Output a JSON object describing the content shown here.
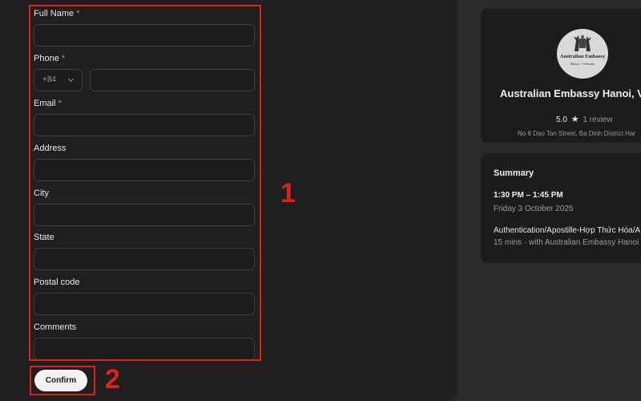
{
  "form": {
    "fields": [
      {
        "label": "Full Name",
        "required_mark": "*",
        "value": "",
        "placeholder": ""
      },
      {
        "label": "Phone",
        "required_mark": "*",
        "country_code": "+84",
        "value": "",
        "placeholder": ""
      },
      {
        "label": "Email",
        "required_mark": "*",
        "value": "",
        "placeholder": ""
      },
      {
        "label": "Address",
        "value": "",
        "placeholder": ""
      },
      {
        "label": "City",
        "value": "",
        "placeholder": ""
      },
      {
        "label": "State",
        "value": "",
        "placeholder": ""
      },
      {
        "label": "Postal code",
        "value": "",
        "placeholder": ""
      },
      {
        "label": "Comments",
        "value": "",
        "placeholder": ""
      }
    ],
    "confirm_label": "Confirm"
  },
  "annotations": {
    "form_marker": "1",
    "confirm_marker": "2",
    "highlight_color": "#e0201c"
  },
  "embassy": {
    "logo_text": "Australian Embassy",
    "logo_subtext": "Hanoi - Vietnam",
    "name": "Australian Embassy Hanoi, Vie",
    "rating": "5.0",
    "star_icon": "star-icon",
    "reviews": "1 review",
    "address": "No 8 Dao Tan Street, Ba Dinh District Har"
  },
  "summary": {
    "title": "Summary",
    "time_range": "1:30 PM – 1:45 PM",
    "date": "Friday 3 October 2025",
    "service": "Authentication/Apostille-Hợp Thức Hóa/A",
    "detail": "15 mins · with Australian Embassy Hanoi"
  }
}
